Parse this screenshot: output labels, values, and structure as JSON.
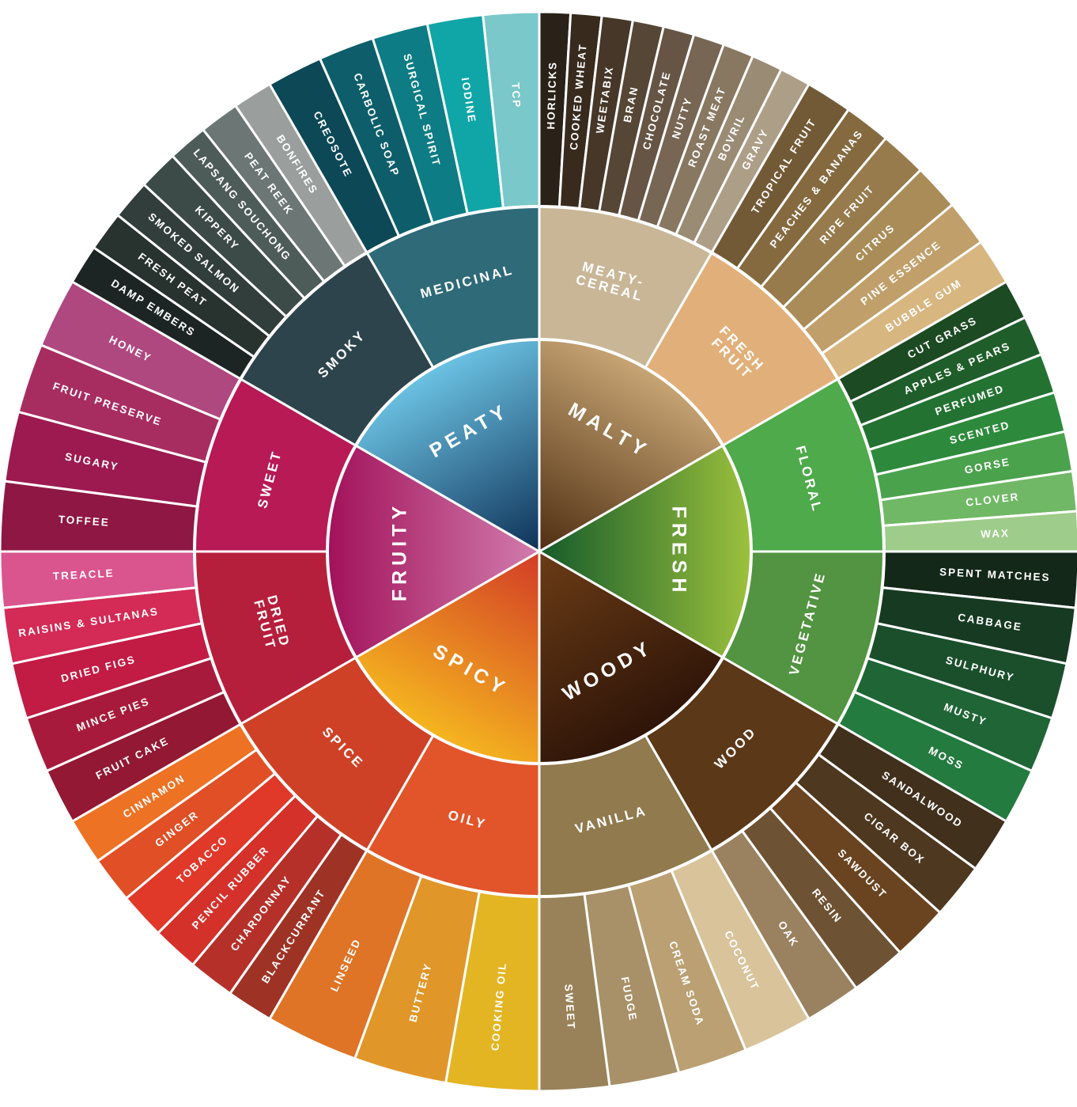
{
  "wheel": {
    "categories": [
      {
        "label": "MALTY",
        "colors": [
          "#c7a574",
          "#4f2e12"
        ],
        "families": [
          {
            "label": "MEATY-\nCEREAL",
            "color": "#c8b697",
            "notes": [
              {
                "label": "HORLICKS",
                "color": "#2a2218"
              },
              {
                "label": "COOKED WHEAT",
                "color": "#382b1e"
              },
              {
                "label": "WEETABIX",
                "color": "#463729"
              },
              {
                "label": "BRAN",
                "color": "#564636"
              },
              {
                "label": "CHOCOLATE",
                "color": "#665545"
              },
              {
                "label": "NUTTY",
                "color": "#776653"
              },
              {
                "label": "ROAST MEAT",
                "color": "#887861"
              },
              {
                "label": "BOVRIL",
                "color": "#9a8b74"
              },
              {
                "label": "GRAVY",
                "color": "#ad9e88"
              }
            ]
          },
          {
            "label": "FRESH\nFRUIT",
            "color": "#e1b07a",
            "notes": [
              {
                "label": "TROPICAL FRUIT",
                "color": "#735a36"
              },
              {
                "label": "PEACHES & BANANAS",
                "color": "#856a40"
              },
              {
                "label": "RIPE FRUIT",
                "color": "#977b4c"
              },
              {
                "label": "CITRUS",
                "color": "#a98c58"
              },
              {
                "label": "PINE ESSENCE",
                "color": "#c09f6a"
              },
              {
                "label": "BUBBLE GUM",
                "color": "#d8b680"
              }
            ]
          }
        ]
      },
      {
        "label": "FRESH",
        "colors": [
          "#9cc13d",
          "#145a2a"
        ],
        "families": [
          {
            "label": "FLORAL",
            "color": "#4eaa4a",
            "notes": [
              {
                "label": "CUT GRASS",
                "color": "#1c4a22"
              },
              {
                "label": "APPLES & PEARS",
                "color": "#1f5e2a"
              },
              {
                "label": "PERFUMED",
                "color": "#237232"
              },
              {
                "label": "SCENTED",
                "color": "#2d8a3c"
              },
              {
                "label": "GORSE",
                "color": "#4ba24c"
              },
              {
                "label": "CLOVER",
                "color": "#70b866"
              },
              {
                "label": "WAX",
                "color": "#9ecc8a"
              }
            ]
          },
          {
            "label": "VEGETATIVE",
            "color": "#529441",
            "notes": [
              {
                "label": "SPENT MATCHES",
                "color": "#14281a"
              },
              {
                "label": "CABBAGE",
                "color": "#173a22"
              },
              {
                "label": "SULPHURY",
                "color": "#1b4f2c"
              },
              {
                "label": "MUSTY",
                "color": "#1f6536"
              },
              {
                "label": "MOSS",
                "color": "#247b3f"
              }
            ]
          }
        ]
      },
      {
        "label": "WOODY",
        "colors": [
          "#2e1408",
          "#6b3c16"
        ],
        "families": [
          {
            "label": "WOOD",
            "color": "#5b3818",
            "notes": [
              {
                "label": "SANDALWOOD",
                "color": "#40301c"
              },
              {
                "label": "CIGAR BOX",
                "color": "#4e381f"
              },
              {
                "label": "SAWDUST",
                "color": "#6a4421"
              },
              {
                "label": "RESIN",
                "color": "#6e5234"
              },
              {
                "label": "OAK",
                "color": "#9a8260"
              }
            ]
          },
          {
            "label": "VANILLA",
            "color": "#907a4e",
            "notes": [
              {
                "label": "COCONUT",
                "color": "#d8c39b"
              },
              {
                "label": "CREAM SODA",
                "color": "#baa072"
              },
              {
                "label": "FUDGE",
                "color": "#a89068"
              },
              {
                "label": "SWEET",
                "color": "#998259"
              }
            ]
          }
        ]
      },
      {
        "label": "SPICY",
        "colors": [
          "#f5b51f",
          "#d23b26"
        ],
        "families": [
          {
            "label": "OILY",
            "color": "#e2542a",
            "notes": [
              {
                "label": "COOKING OIL",
                "color": "#e3b523"
              },
              {
                "label": "BUTTERY",
                "color": "#e09628"
              },
              {
                "label": "LINSEED",
                "color": "#df7426"
              }
            ]
          },
          {
            "label": "SPICE",
            "color": "#cf4127",
            "notes": [
              {
                "label": "BLACKCURRANT",
                "color": "#9e3325"
              },
              {
                "label": "CHARDONNAY",
                "color": "#b6302a"
              },
              {
                "label": "PENCIL RUBBER",
                "color": "#d4312b"
              },
              {
                "label": "TOBACCO",
                "color": "#e0392a"
              },
              {
                "label": "GINGER",
                "color": "#e04f25"
              },
              {
                "label": "CINNAMON",
                "color": "#ed7224"
              }
            ]
          }
        ]
      },
      {
        "label": "FRUITY",
        "colors": [
          "#a2115a",
          "#d17dae"
        ],
        "families": [
          {
            "label": "DRIED\nFRUIT",
            "color": "#b61f3c",
            "notes": [
              {
                "label": "FRUIT CAKE",
                "color": "#921833"
              },
              {
                "label": "MINCE PIES",
                "color": "#a81a3b"
              },
              {
                "label": "DRIED FIGS",
                "color": "#c21b44"
              },
              {
                "label": "RAISINS & SULTANAS",
                "color": "#d42a56"
              },
              {
                "label": "TREACLE",
                "color": "#da548e"
              }
            ]
          },
          {
            "label": "SWEET",
            "color": "#b71a55",
            "notes": [
              {
                "label": "TOFFEE",
                "color": "#8f1743"
              },
              {
                "label": "SUGARY",
                "color": "#9c1a50"
              },
              {
                "label": "FRUIT PRESERVE",
                "color": "#a72d61"
              },
              {
                "label": "HONEY",
                "color": "#b04880"
              }
            ]
          }
        ]
      },
      {
        "label": "PEATY",
        "colors": [
          "#6bc2e3",
          "#0e3157"
        ],
        "families": [
          {
            "label": "SMOKY",
            "color": "#2d444c",
            "notes": [
              {
                "label": "DAMP EMBERS",
                "color": "#1c2523"
              },
              {
                "label": "FRESH PEAT",
                "color": "#28322f"
              },
              {
                "label": "SMOKED SALMON",
                "color": "#323e3b"
              },
              {
                "label": "KIPPERY",
                "color": "#3d4b48"
              },
              {
                "label": "LAPSANG SOUCHONG",
                "color": "#4e5c59"
              },
              {
                "label": "PEAT REEK",
                "color": "#6b7675"
              },
              {
                "label": "BONFIRES",
                "color": "#9a9f9e"
              }
            ]
          },
          {
            "label": "MEDICINAL",
            "color": "#2e6a78",
            "notes": [
              {
                "label": "CREOSOTE",
                "color": "#0d4856"
              },
              {
                "label": "CARBOLIC SOAP",
                "color": "#0d5e6a"
              },
              {
                "label": "SURGICAL SPIRIT",
                "color": "#0d7c84"
              },
              {
                "label": "IODINE",
                "color": "#10a6a7"
              },
              {
                "label": "TCP",
                "color": "#7ac8c9"
              }
            ]
          }
        ]
      }
    ]
  }
}
